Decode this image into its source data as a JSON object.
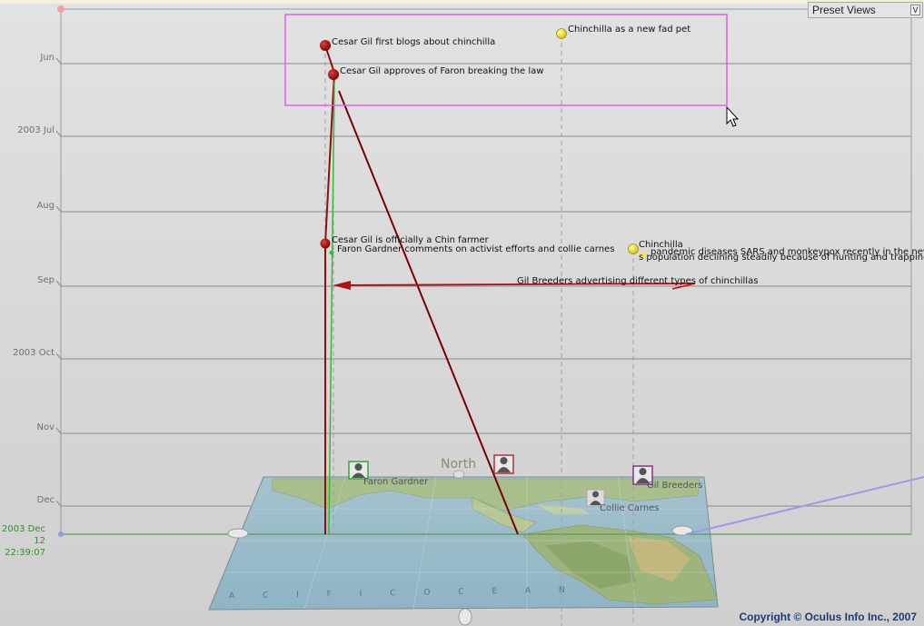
{
  "toolbar": {
    "preset_views_label": "Preset Views",
    "preset_chevron": "V"
  },
  "timeline": {
    "months": [
      "Jun",
      "2003 Jul",
      "Aug",
      "Sep",
      "2003 Oct",
      "Nov",
      "Dec"
    ],
    "current_date": "2003 Dec 12",
    "current_time": "22:39:07"
  },
  "events": {
    "cesar_blogs": "Cesar Gil first blogs about chinchilla",
    "fad_pet": "Chinchilla as a new fad pet",
    "cesar_approves": "Cesar Gil approves of Faron breaking the law",
    "cesar_farmer": "Cesar Gil is officially a Chin farmer",
    "faron_comments": "Faron Gardner comments on activist efforts and collie carnes",
    "chinchilla": "Chinchilla",
    "pandemic": "pandemic diseases SARS and monkeypox recently in the new",
    "population": "s population declining steadily because of hunting and trapping",
    "gil_breeders_ad": "Gil Breeders advertising different types of chinchillas"
  },
  "people": {
    "faron": "Faron Gardner",
    "gil_breeders": "Gil Breeders",
    "collie": "Collie Carnes"
  },
  "map": {
    "north_label": "North",
    "ocean_letters": "A C I F I C   O C E A N"
  },
  "footer": {
    "copyright": "Copyright © Oculus Info Inc., 2007"
  },
  "colors": {
    "event_red": "#8b1010",
    "event_yellow": "#ffee33",
    "selection_magenta": "#e060e0",
    "link_green": "#33bb33",
    "time_axis_green": "#5a9a5a",
    "blue_link": "#9999ee",
    "copyright_blue": "#1e3b74"
  },
  "icons": [
    "person-icon",
    "cursor-arrow-icon",
    "chevron-down-icon"
  ]
}
